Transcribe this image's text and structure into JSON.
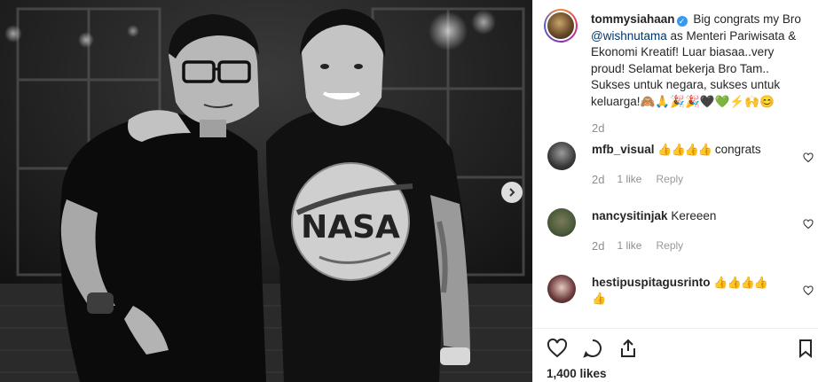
{
  "post": {
    "username": "tommysiahaan",
    "caption_pre": "Big congrats my Bro ",
    "caption_mention": "@wishnutama",
    "caption_post": " as Menteri Pariwisata & Ekonomi Kreatif! Luar biasaa..very proud! Selamat bekerja Bro Tam.. Sukses untuk negara, sukses untuk keluarga!",
    "caption_emojis": "🙈🙏🎉🎉🖤💚⚡🙌😊",
    "time": "2d",
    "likes": "1,400 likes"
  },
  "photo": {
    "shirt_text": "NASA"
  },
  "comments": [
    {
      "username": "mfb_visual",
      "text": "congrats",
      "thumbs": "👍👍👍👍",
      "time": "2d",
      "likes": "1 like",
      "reply": "Reply"
    },
    {
      "username": "nancysitinjak",
      "text": "Kereeen",
      "thumbs": "",
      "time": "2d",
      "likes": "1 like",
      "reply": "Reply"
    },
    {
      "username": "hestipuspitagusrinto",
      "text": "",
      "thumbs": "👍👍👍👍",
      "thumbs2": "👍",
      "time": "",
      "likes": "",
      "reply": ""
    }
  ],
  "icons": {
    "like": "heart-icon",
    "comment": "comment-icon",
    "share": "share-icon",
    "save": "bookmark-icon",
    "next": "chevron-right-icon",
    "verified": "verified-badge-icon"
  },
  "colors": {
    "text": "#262626",
    "muted": "#8e8e8e",
    "mention": "#003569",
    "verified": "#3897f0"
  }
}
